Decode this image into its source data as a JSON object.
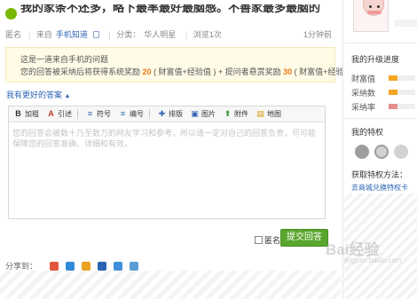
{
  "question": {
    "title": "我的家条不还多，略下最率最好最脑感。不善家最多最脑的",
    "meta": {
      "anonymous_label": "匿名",
      "from_prefix": "来自",
      "from_link": "手机知道",
      "category_prefix": "分类：",
      "category": "华人明星",
      "views": "浏览1次",
      "time": "1分钟前"
    }
  },
  "notice": {
    "line1": "这是一道来自手机的问题",
    "line2_a": "您的回答被采纳后将获得系统奖励",
    "reward1": "20",
    "line2_b": "( 财富值+经验值 ) + 提问者悬赏",
    "line2_c": "奖励",
    "reward2": "30",
    "line2_d": "( 财富值+经验值 )"
  },
  "better_answer": {
    "label": "我有更好的答案",
    "caret": "▲"
  },
  "editor": {
    "toolbar": [
      {
        "name": "bold",
        "icon": "B",
        "label": "加粗",
        "color": "#333333"
      },
      {
        "name": "quote",
        "icon": "A",
        "label": "引述",
        "color": "#c0392b"
      },
      {
        "name": "symbol",
        "icon": "≡",
        "label": "符号",
        "color": "#2d64b3"
      },
      {
        "name": "numbering",
        "icon": "≡",
        "label": "编号",
        "color": "#2d64b3"
      },
      {
        "name": "layout",
        "icon": "✚",
        "label": "排版",
        "color": "#2d64b3"
      },
      {
        "name": "image",
        "icon": "▣",
        "label": "图片",
        "color": "#2d64b3"
      },
      {
        "name": "attach",
        "icon": "⬆",
        "label": "附件",
        "color": "#3a9a3a"
      },
      {
        "name": "map",
        "icon": "▤",
        "label": "地图",
        "color": "#d49b00"
      }
    ],
    "placeholder": "您的回答会被数十乃至数万的网友学习和参考，所以请一定对自己的回答负责，尽可能保障您的回答准确、详细和有效。"
  },
  "submit": {
    "anonymous": "匿名",
    "button": "提交回答"
  },
  "share": {
    "label": "分享到：",
    "colors": [
      "#e2553c",
      "#2d8ad6",
      "#e9a320",
      "#2d64b3",
      "#3f8fdc",
      "#5a9fd6"
    ]
  },
  "sidebar": {
    "upgrade_title": "我的升级进度",
    "rows": [
      {
        "k": "财富值"
      },
      {
        "k": "采纳数"
      },
      {
        "k": "采纳率"
      }
    ],
    "perk_title": "我的特权",
    "obtain_title": "获取特权方法：",
    "obtain_link": "去商城兑换特权卡"
  },
  "watermark": {
    "main": "Bai经验",
    "sub": "jingyan.baidu.com"
  }
}
